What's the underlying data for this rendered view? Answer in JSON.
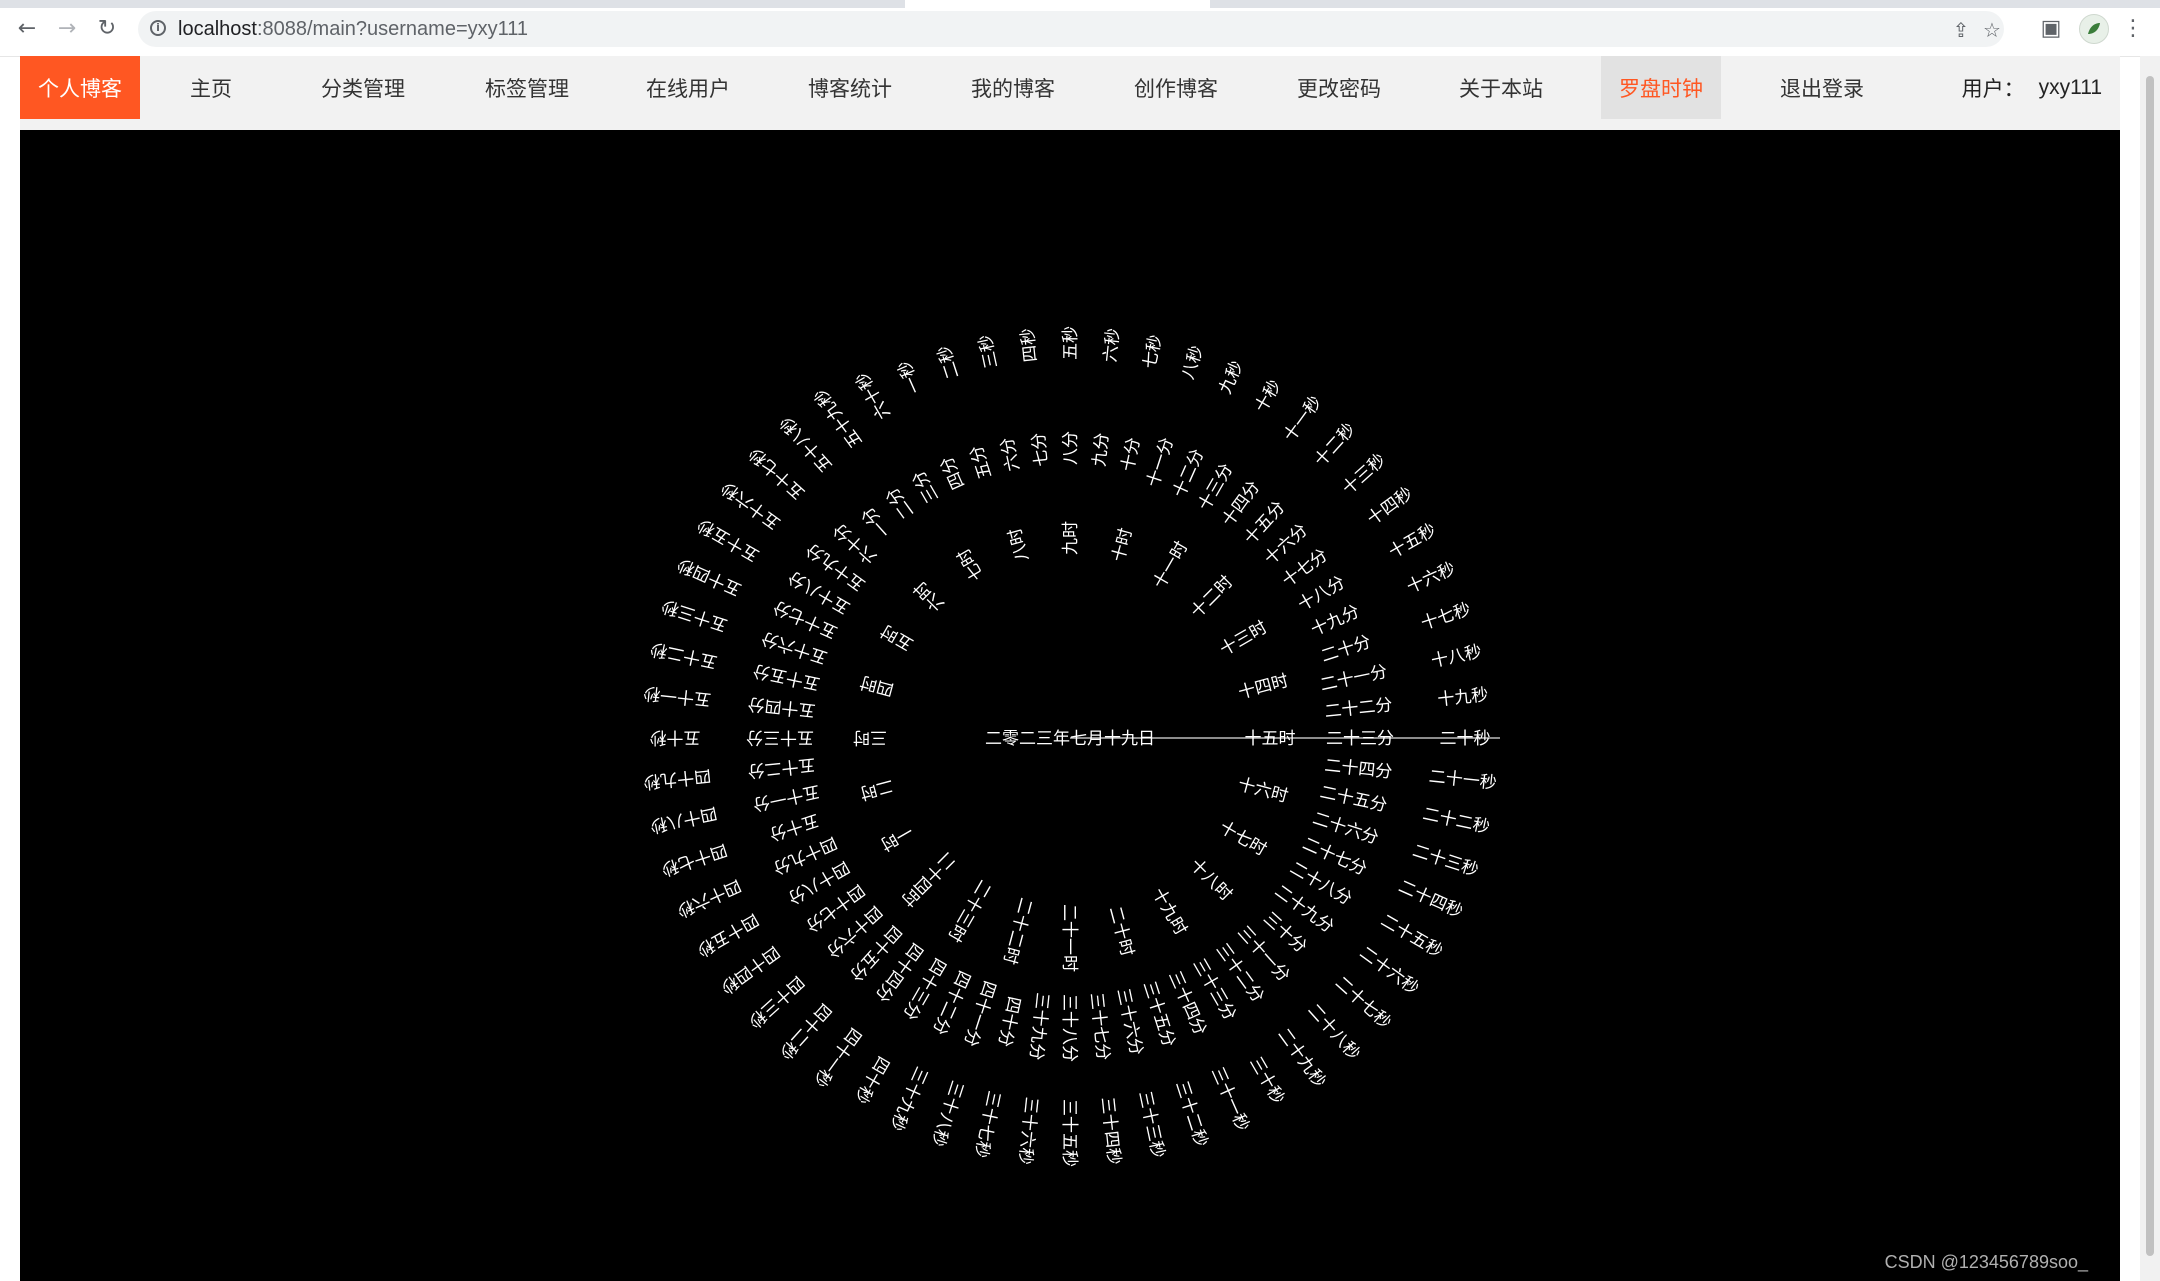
{
  "browser": {
    "url_host": "localhost",
    "url_rest": ":8088/main?username=yxy111",
    "back_icon": "←",
    "forward_icon": "→",
    "reload_icon": "↻",
    "info_icon": "i",
    "share_icon": "⇪",
    "star_icon": "☆",
    "sidepanel_icon": "▣",
    "menu_icon": "⋮"
  },
  "nav": {
    "brand": "个人博客",
    "items": [
      {
        "label": "主页",
        "active": false
      },
      {
        "label": "分类管理",
        "active": false
      },
      {
        "label": "标签管理",
        "active": false
      },
      {
        "label": "在线用户",
        "active": false
      },
      {
        "label": "博客统计",
        "active": false
      },
      {
        "label": "我的博客",
        "active": false
      },
      {
        "label": "创作博客",
        "active": false
      },
      {
        "label": "更改密码",
        "active": false
      },
      {
        "label": "关于本站",
        "active": false
      },
      {
        "label": "罗盘时钟",
        "active": true
      },
      {
        "label": "退出登录",
        "active": false
      }
    ],
    "user_label": "用户：",
    "username": "yxy111"
  },
  "clock": {
    "date_text": "二零二三年七月十九日",
    "hours": [
      "一时",
      "二时",
      "三时",
      "四时",
      "五时",
      "六时",
      "七时",
      "八时",
      "九时",
      "十时",
      "十一时",
      "十二时",
      "十三时",
      "十四时",
      "十五时",
      "十六时",
      "十七时",
      "十八时",
      "十九时",
      "二十时",
      "二十一时",
      "二十二时",
      "二十三时",
      "二十四时"
    ],
    "minutes": [
      "一分",
      "二分",
      "三分",
      "四分",
      "五分",
      "六分",
      "七分",
      "八分",
      "九分",
      "十分",
      "十一分",
      "十二分",
      "十三分",
      "十四分",
      "十五分",
      "十六分",
      "十七分",
      "十八分",
      "十九分",
      "二十分",
      "二十一分",
      "二十二分",
      "二十三分",
      "二十四分",
      "二十五分",
      "二十六分",
      "二十七分",
      "二十八分",
      "二十九分",
      "三十分",
      "三十一分",
      "三十二分",
      "三十三分",
      "三十四分",
      "三十五分",
      "三十六分",
      "三十七分",
      "三十八分",
      "三十九分",
      "四十分",
      "四十一分",
      "四十二分",
      "四十三分",
      "四十四分",
      "四十五分",
      "四十六分",
      "四十七分",
      "四十八分",
      "四十九分",
      "五十分",
      "五十一分",
      "五十二分",
      "五十三分",
      "五十四分",
      "五十五分",
      "五十六分",
      "五十七分",
      "五十八分",
      "五十九分",
      "六十分"
    ],
    "seconds": [
      "一秒",
      "二秒",
      "三秒",
      "四秒",
      "五秒",
      "六秒",
      "七秒",
      "八秒",
      "九秒",
      "十秒",
      "十一秒",
      "十二秒",
      "十三秒",
      "十四秒",
      "十五秒",
      "十六秒",
      "十七秒",
      "十八秒",
      "十九秒",
      "二十秒",
      "二十一秒",
      "二十二秒",
      "二十三秒",
      "二十四秒",
      "二十五秒",
      "二十六秒",
      "二十七秒",
      "二十八秒",
      "二十九秒",
      "三十秒",
      "三十一秒",
      "三十二秒",
      "三十三秒",
      "三十四秒",
      "三十五秒",
      "三十六秒",
      "三十七秒",
      "三十八秒",
      "三十九秒",
      "四十秒",
      "四十一秒",
      "四十二秒",
      "四十三秒",
      "四十四秒",
      "四十五秒",
      "四十六秒",
      "四十七秒",
      "四十八秒",
      "四十九秒",
      "五十秒",
      "五十一秒",
      "五十二秒",
      "五十三秒",
      "五十四秒",
      "五十五秒",
      "五十六秒",
      "五十七秒",
      "五十八秒",
      "五十九秒",
      "六十秒"
    ],
    "current_hour": "十五时",
    "current_minute": "二十三分",
    "current_second": "二十秒"
  },
  "watermark": "CSDN @123456789soo_"
}
